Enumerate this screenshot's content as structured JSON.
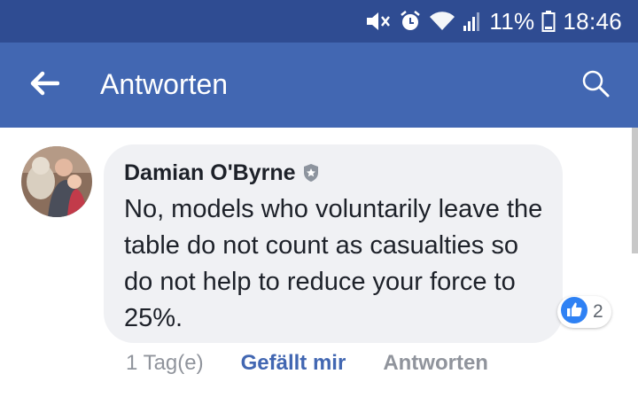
{
  "status_bar": {
    "battery": "11%",
    "time": "18:46",
    "icons": [
      "mute-icon",
      "alarm-icon",
      "wifi-icon",
      "signal-icon",
      "battery-icon"
    ]
  },
  "app_bar": {
    "title": "Antworten",
    "back_icon": "arrow-left-icon",
    "search_icon": "search-icon",
    "color": "#4267b2"
  },
  "comment": {
    "author": "Damian O'Byrne",
    "badge_icon": "shield-badge-icon",
    "text": "No, models who voluntarily leave the table do not count as casualties so do not help to reduce your force to 25%.",
    "reaction_icon": "thumbs-up-icon",
    "reaction_count": "2",
    "time": "1 Tag(e)",
    "like_label": "Gefällt mir",
    "reply_label": "Antworten"
  },
  "colors": {
    "status_bar": "#2f4c92",
    "accent": "#4267b2",
    "bubble": "#f0f1f4",
    "secondary_text": "#90949c"
  }
}
